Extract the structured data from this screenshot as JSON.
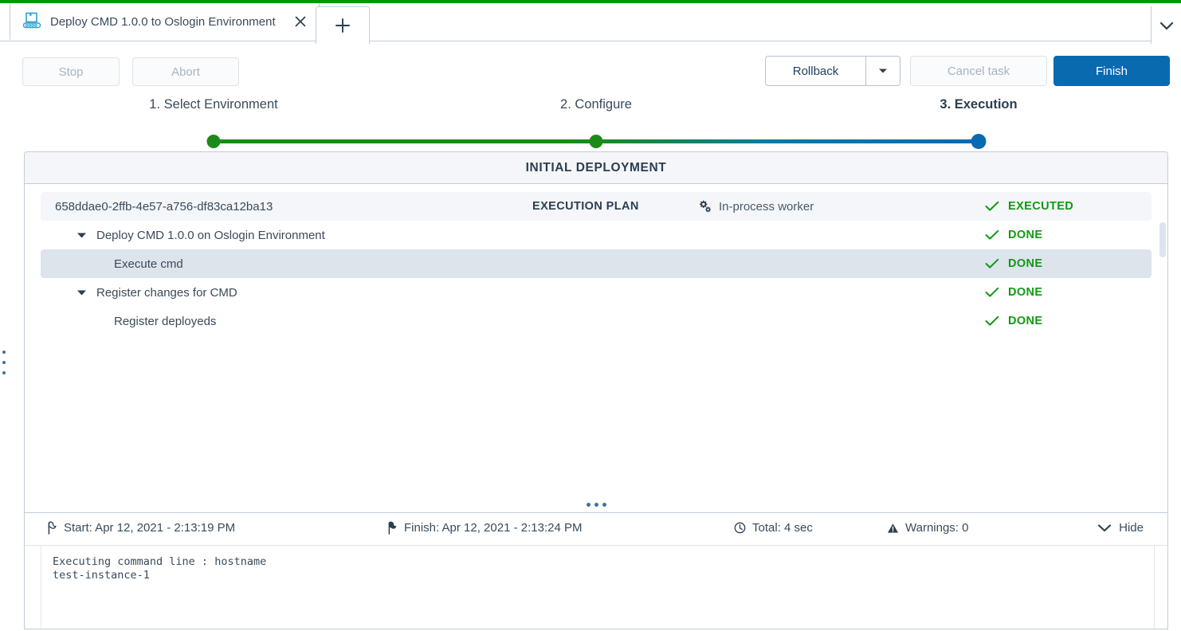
{
  "window": {
    "accent_green": "#009900",
    "accent_blue": "#0a6ab0"
  },
  "tabbar": {
    "tab": {
      "title": "Deploy CMD 1.0.0 to Oslogin Environment",
      "icon": "deployment-conveyor-icon",
      "close_icon": "close-icon"
    },
    "new_tab_icon": "plus-icon",
    "overflow_icon": "chevron-down-icon"
  },
  "toolbar": {
    "stop_label": "Stop",
    "abort_label": "Abort",
    "rollback_label": "Rollback",
    "rollback_caret_icon": "caret-down-icon",
    "cancel_task_label": "Cancel task",
    "finish_label": "Finish"
  },
  "stepper": {
    "steps": [
      {
        "label": "1. Select Environment",
        "state": "done"
      },
      {
        "label": "2. Configure",
        "state": "done"
      },
      {
        "label": "3. Execution",
        "state": "active"
      }
    ]
  },
  "panel": {
    "header": "INITIAL DEPLOYMENT",
    "rows": [
      {
        "name": "658ddae0-2ffb-4e57-a756-df83ca12ba13",
        "plan_label": "EXECUTION PLAN",
        "worker": "In-process worker",
        "worker_icon": "gears-icon",
        "status": "EXECUTED",
        "status_icon": "check-icon"
      },
      {
        "name": "Deploy CMD 1.0.0 on Oslogin Environment",
        "status": "DONE",
        "status_icon": "check-icon",
        "caret_icon": "caret-down-icon"
      },
      {
        "name": "Execute cmd",
        "status": "DONE",
        "status_icon": "check-icon"
      },
      {
        "name": "Register changes for CMD",
        "status": "DONE",
        "status_icon": "check-icon",
        "caret_icon": "caret-down-icon"
      },
      {
        "name": "Register deployeds",
        "status": "DONE",
        "status_icon": "check-icon"
      }
    ]
  },
  "stats": {
    "start": "Start: Apr 12, 2021 - 2:13:19 PM",
    "start_icon": "flag-outline-icon",
    "finish": "Finish: Apr 12, 2021 - 2:13:24 PM",
    "finish_icon": "flag-filled-icon",
    "total": "Total: 4 sec",
    "total_icon": "clock-icon",
    "warnings": "Warnings: 0",
    "warnings_icon": "warning-triangle-icon",
    "hide_label": "Hide",
    "hide_icon": "chevron-down-icon"
  },
  "log": {
    "text": "Executing command line : hostname\ntest-instance-1"
  }
}
